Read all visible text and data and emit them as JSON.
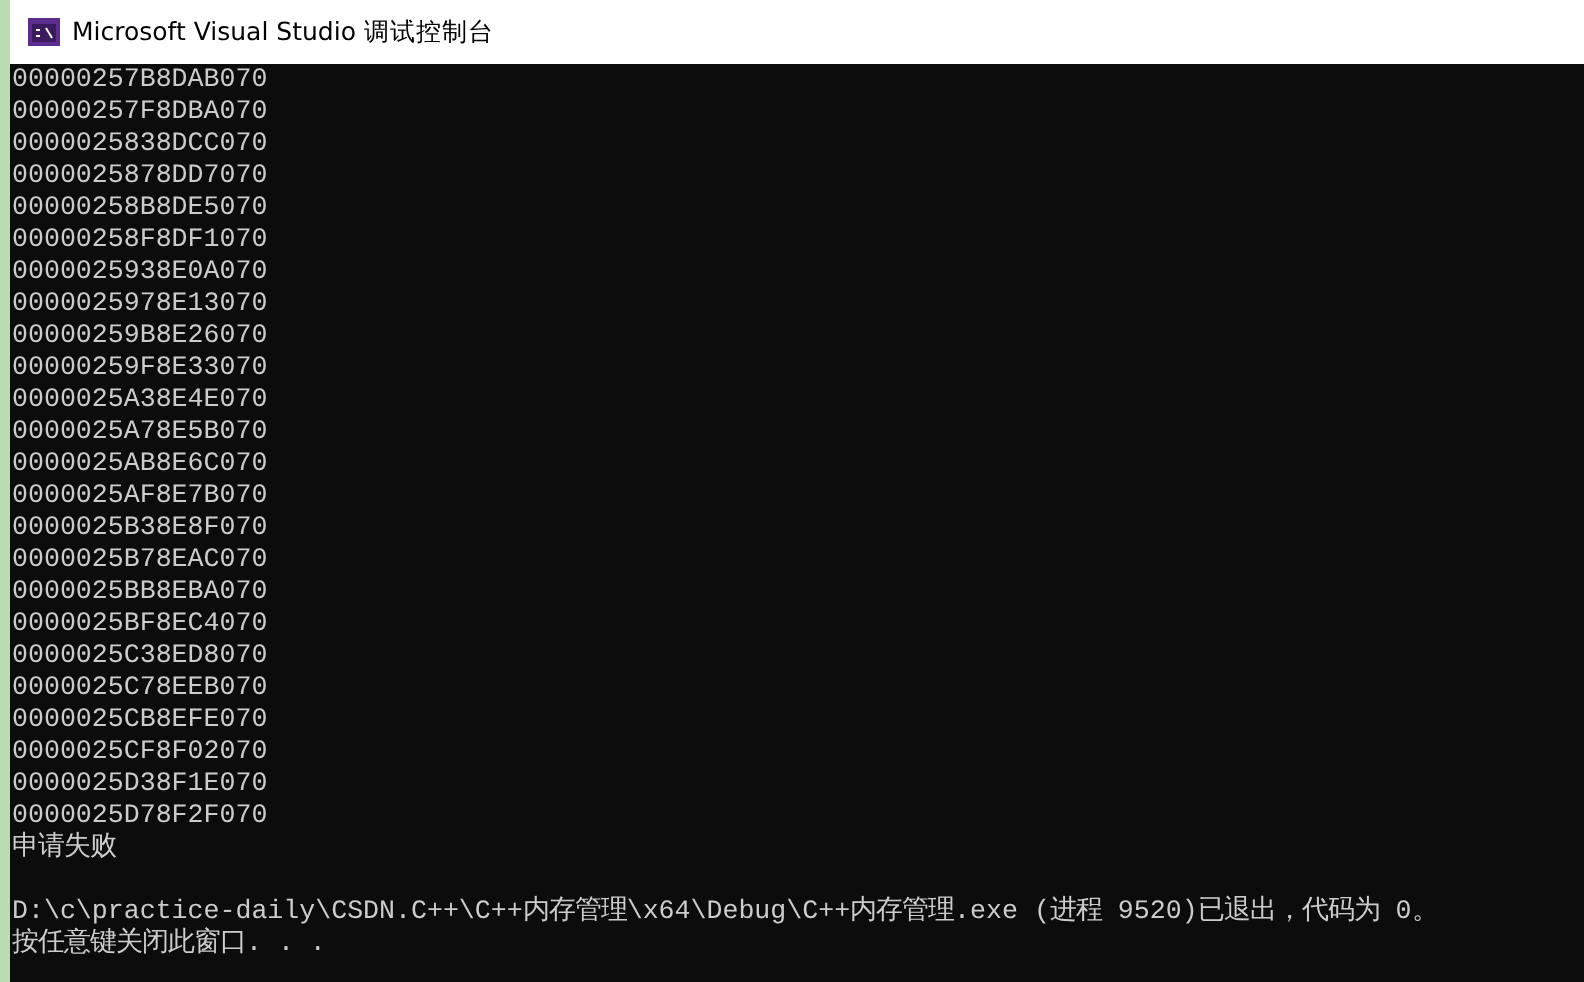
{
  "window": {
    "title": "Microsoft Visual Studio 调试控制台"
  },
  "console": {
    "addresses": [
      "00000257B8DAB070",
      "00000257F8DBA070",
      "0000025838DCC070",
      "0000025878DD7070",
      "00000258B8DE5070",
      "00000258F8DF1070",
      "0000025938E0A070",
      "0000025978E13070",
      "00000259B8E26070",
      "00000259F8E33070",
      "0000025A38E4E070",
      "0000025A78E5B070",
      "0000025AB8E6C070",
      "0000025AF8E7B070",
      "0000025B38E8F070",
      "0000025B78EAC070",
      "0000025BB8EBA070",
      "0000025BF8EC4070",
      "0000025C38ED8070",
      "0000025C78EEB070",
      "0000025CB8EFE070",
      "0000025CF8F02070",
      "0000025D38F1E070",
      "0000025D78F2F070"
    ],
    "error_message": "申请失败",
    "exit_message": "D:\\c\\practice-daily\\CSDN.C++\\C++内存管理\\x64\\Debug\\C++内存管理.exe (进程 9520)已退出，代码为 0。",
    "prompt": "按任意键关闭此窗口. . ."
  }
}
